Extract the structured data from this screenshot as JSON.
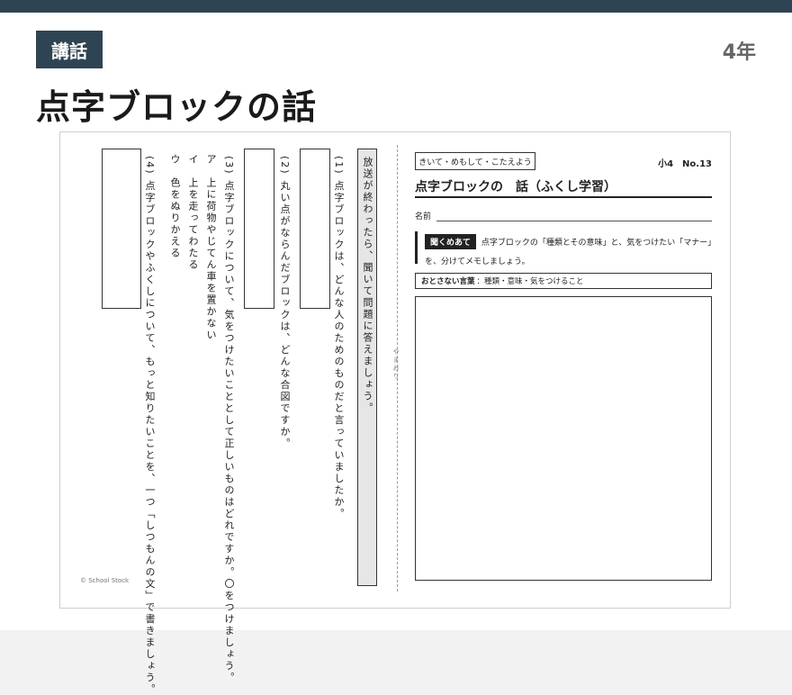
{
  "header": {
    "category": "講話",
    "grade": "4年",
    "title": "点字ブロックの話"
  },
  "worksheet": {
    "left": {
      "instruction": "放送が終わったら、聞いて問題に答えましょう。",
      "q1": "(1) 点字ブロックは、どんな人のためのものだと言っていましたか。",
      "q2": "(2) 丸い点がならんだブロックは、どんな合図ですか。",
      "q3": "(3) 点字ブロックについて、気をつけたいこととして正しいものはどれですか。〇をつけましょう。",
      "q3_opt_a": "ア　上に荷物やじてん車を置かない",
      "q3_opt_b": "イ　上を走ってわたる",
      "q3_opt_c": "ウ　色をぬりかえる",
      "q4": "(4) 点字ブロックやふくしについて、もっと知りたいことを、一つ「しつもんの文」で書きましょう。",
      "fold_label": "やまおり",
      "copyright": "© School Stock"
    },
    "right": {
      "tag": "きいて・めもして・こたえよう",
      "number": "小4　No.13",
      "title": "点字ブロックの　話（ふくし学習）",
      "name_label": "名前",
      "instruction_badge": "聞くめあて",
      "instruction_text": "点字ブロックの「種類とその意味」と、気をつけたい「マナー」を、分けてメモしましょう。",
      "keywords_label": "おとさない言葉",
      "keywords_text": "：種類・意味・気をつけること"
    }
  }
}
